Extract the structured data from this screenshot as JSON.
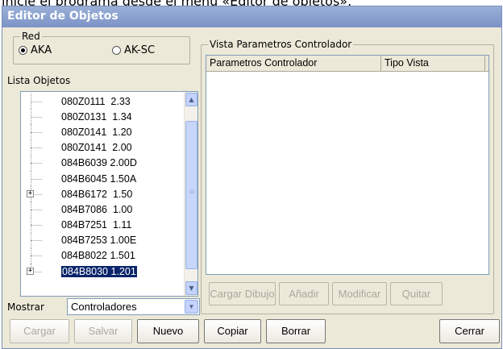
{
  "caption": "inicie el programa desde el menú «Editor de objetos».",
  "window": {
    "title": "Editor de Objetos"
  },
  "red_group": {
    "label": "Red",
    "options": [
      {
        "label": "AKA",
        "checked": true
      },
      {
        "label": "AK-SC",
        "checked": false
      }
    ]
  },
  "lista_objetos": {
    "label": "Lista Objetos",
    "items": [
      {
        "code": "080Z0111",
        "ver": "2.33",
        "expand": false,
        "selected": false
      },
      {
        "code": "080Z0131",
        "ver": "1.34",
        "expand": false,
        "selected": false
      },
      {
        "code": "080Z0141",
        "ver": "1.20",
        "expand": false,
        "selected": false
      },
      {
        "code": "080Z0141",
        "ver": "2.00",
        "expand": false,
        "selected": false
      },
      {
        "code": "084B6039",
        "ver": "2.00D",
        "expand": false,
        "selected": false
      },
      {
        "code": "084B6045",
        "ver": "1.50A",
        "expand": false,
        "selected": false
      },
      {
        "code": "084B6172",
        "ver": "1.50",
        "expand": true,
        "selected": false
      },
      {
        "code": "084B7086",
        "ver": "1.00",
        "expand": false,
        "selected": false
      },
      {
        "code": "084B7251",
        "ver": "1.11",
        "expand": false,
        "selected": false
      },
      {
        "code": "084B7253",
        "ver": "1.00E",
        "expand": false,
        "selected": false
      },
      {
        "code": "084B8022",
        "ver": "1.501",
        "expand": false,
        "selected": false
      },
      {
        "code": "084B8030",
        "ver": "1.201",
        "expand": true,
        "selected": true
      }
    ]
  },
  "mostrar": {
    "label": "Mostrar",
    "value": "Controladores"
  },
  "vista": {
    "label": "Vista Parametros Controlador",
    "columns": [
      "Parametros Controlador",
      "Tipo Vista"
    ]
  },
  "vista_buttons": [
    "Cargar Dibujo",
    "Añadir",
    "Modificar",
    "Quitar"
  ],
  "bottom_buttons": {
    "cargar": "Cargar",
    "salvar": "Salvar",
    "nuevo": "Nuevo",
    "copiar": "Copiar",
    "borrar": "Borrar",
    "cerrar": "Cerrar"
  }
}
